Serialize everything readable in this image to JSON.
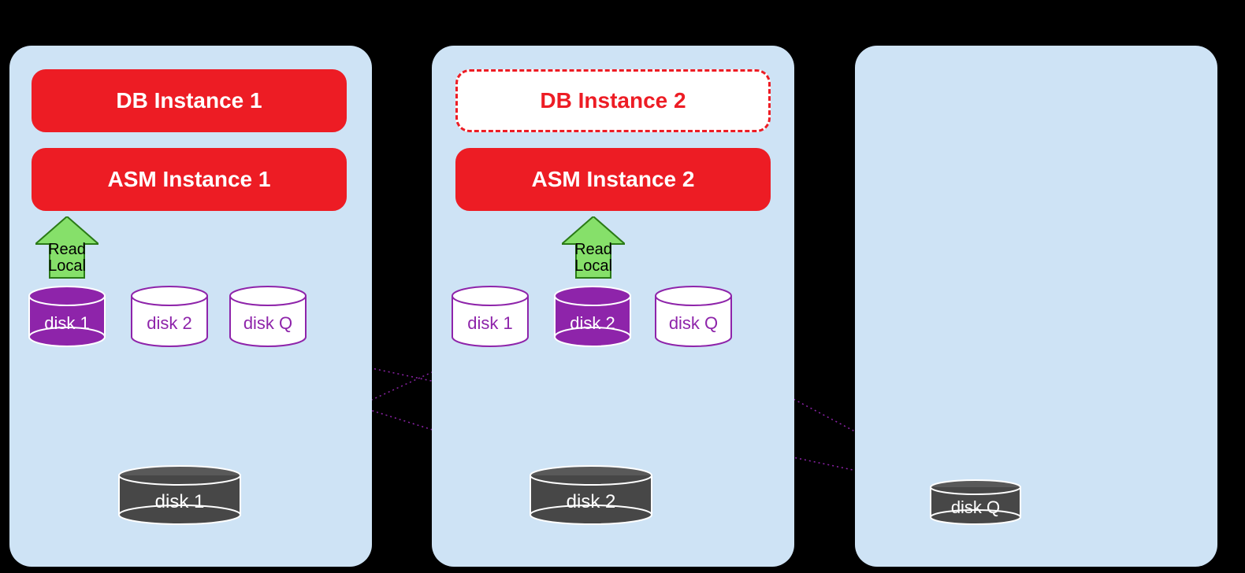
{
  "panels": {
    "left": {
      "db": "DB Instance 1",
      "asm": "ASM Instance 1"
    },
    "middle": {
      "db": "DB Instance 2",
      "asm": "ASM Instance 2"
    },
    "right": {}
  },
  "arrows": {
    "left": {
      "line1": "Read",
      "line2": "Local"
    },
    "middle": {
      "line1": "Read",
      "line2": "Local"
    }
  },
  "small_disks": {
    "left": {
      "d1": "disk 1",
      "d2": "disk 2",
      "dq": "disk Q"
    },
    "middle": {
      "d1": "disk 1",
      "d2": "disk 2",
      "dq": "disk Q"
    }
  },
  "big_disks": {
    "left": "disk 1",
    "middle": "disk 2",
    "right": "disk Q"
  },
  "colors": {
    "panel_bg": "#cee3f5",
    "red": "#ed1c24",
    "purple": "#8e24aa",
    "arrow_fill": "#7ed957",
    "dark_disk": "#474747"
  }
}
